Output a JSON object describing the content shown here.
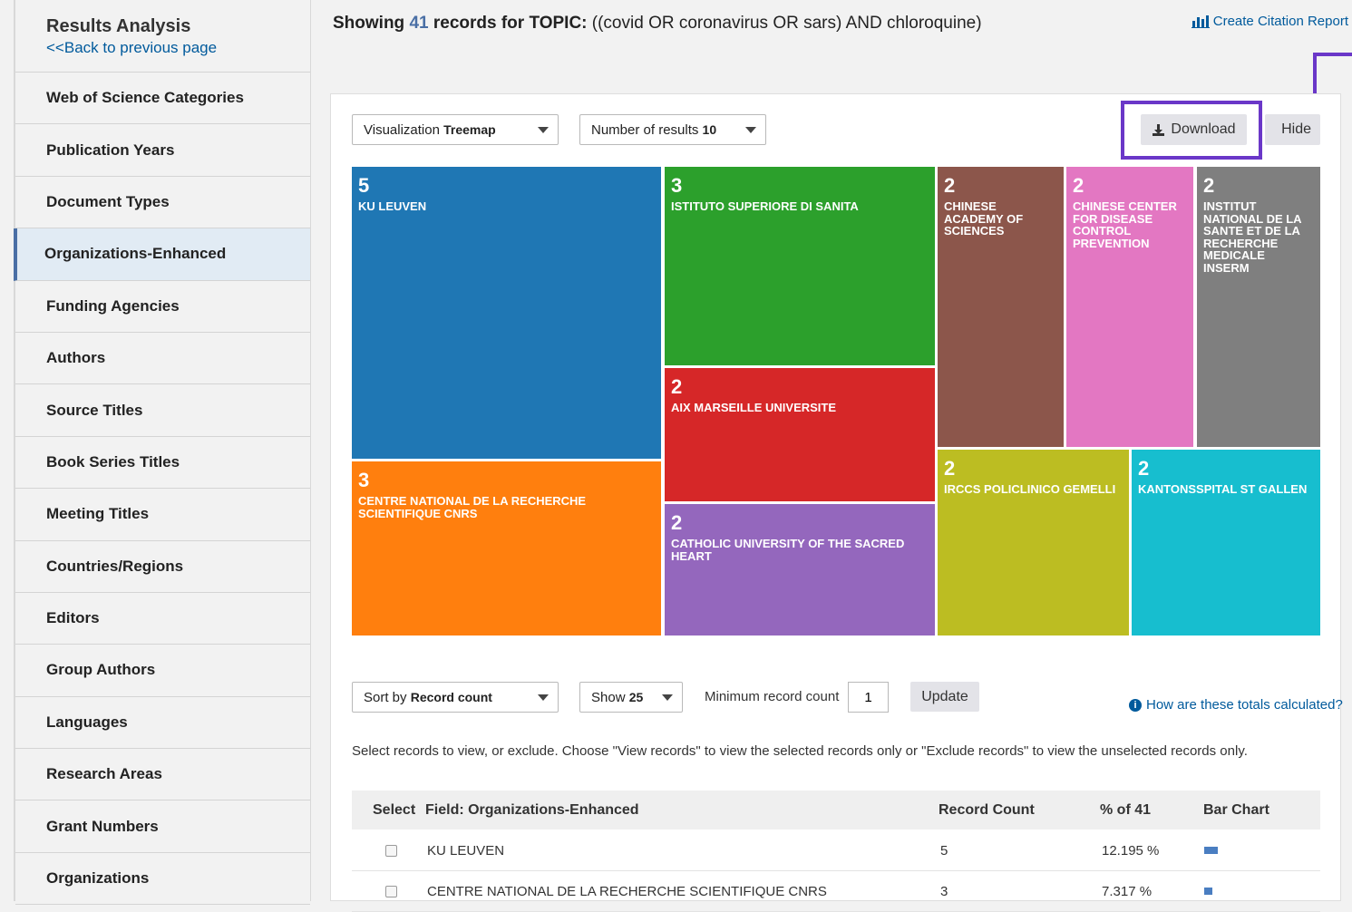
{
  "sidebar": {
    "title": "Results Analysis",
    "back_link": "<<Back to previous page",
    "items": [
      {
        "label": "Web of Science Categories"
      },
      {
        "label": "Publication Years"
      },
      {
        "label": "Document Types"
      },
      {
        "label": "Organizations-Enhanced",
        "active": true
      },
      {
        "label": "Funding Agencies"
      },
      {
        "label": "Authors"
      },
      {
        "label": "Source Titles"
      },
      {
        "label": "Book Series Titles"
      },
      {
        "label": "Meeting Titles"
      },
      {
        "label": "Countries/Regions"
      },
      {
        "label": "Editors"
      },
      {
        "label": "Group Authors"
      },
      {
        "label": "Languages"
      },
      {
        "label": "Research Areas"
      },
      {
        "label": "Grant Numbers"
      },
      {
        "label": "Organizations"
      }
    ]
  },
  "header": {
    "showing": "Showing",
    "count": "41",
    "records_for": "records for",
    "topic_label": "TOPIC:",
    "query": "((covid OR coronavirus OR sars) AND chloroquine)",
    "citation_report": "Create Citation Report"
  },
  "controls": {
    "visualization_label": "Visualization",
    "visualization_value": "Treemap",
    "num_results_label": "Number of results",
    "num_results_value": "10",
    "download": "Download",
    "hide": "Hide",
    "sort_label": "Sort by",
    "sort_value": "Record count",
    "show_label": "Show",
    "show_value": "25",
    "min_count_label": "Minimum record count",
    "min_count_value": "1",
    "update": "Update",
    "how_calculated": "How are these totals calculated?",
    "instructions": "Select records to view, or exclude. Choose \"View records\" to view the selected records only or \"Exclude records\" to view the unselected records only."
  },
  "treemap": [
    {
      "count": "5",
      "name": "KU LEUVEN",
      "color": "#1f77b4"
    },
    {
      "count": "3",
      "name": "ISTITUTO SUPERIORE DI SANITA",
      "color": "#2ca02c"
    },
    {
      "count": "2",
      "name": "CHINESE ACADEMY OF SCIENCES",
      "color": "#8c564b"
    },
    {
      "count": "2",
      "name": "CHINESE CENTER FOR DISEASE CONTROL PREVENTION",
      "color": "#e377c2"
    },
    {
      "count": "2",
      "name": "INSTITUT NATIONAL DE LA SANTE ET DE LA RECHERCHE MEDICALE INSERM",
      "color": "#7f7f7f"
    },
    {
      "count": "2",
      "name": "AIX MARSEILLE UNIVERSITE",
      "color": "#d62728"
    },
    {
      "count": "3",
      "name": "CENTRE NATIONAL DE LA RECHERCHE SCIENTIFIQUE CNRS",
      "color": "#ff7f0e"
    },
    {
      "count": "2",
      "name": "CATHOLIC UNIVERSITY OF THE SACRED HEART",
      "color": "#9467bd"
    },
    {
      "count": "2",
      "name": "IRCCS POLICLINICO GEMELLI",
      "color": "#bcbd22"
    },
    {
      "count": "2",
      "name": "KANTONSSPITAL ST GALLEN",
      "color": "#17becf"
    }
  ],
  "table": {
    "headers": [
      "Select",
      "Field: Organizations-Enhanced",
      "Record Count",
      "% of 41",
      "Bar Chart"
    ],
    "rows": [
      {
        "name": "KU LEUVEN",
        "count": "5",
        "percent": "12.195 %",
        "bar_fraction": 1.0
      },
      {
        "name": "CENTRE NATIONAL DE LA RECHERCHE SCIENTIFIQUE CNRS",
        "count": "3",
        "percent": "7.317 %",
        "bar_fraction": 0.6
      }
    ]
  },
  "colors": {
    "accent": "#4a6fa5",
    "link": "#005a9c",
    "annotation": "#6a37c8"
  }
}
